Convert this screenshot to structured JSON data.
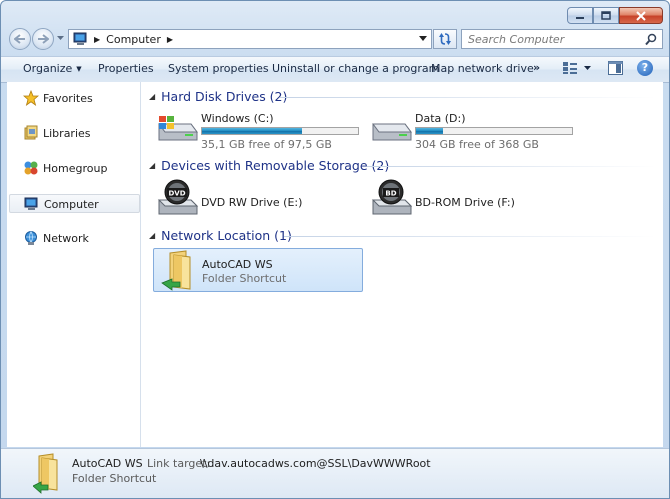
{
  "window": {
    "accent": "#c4d8ee"
  },
  "address": {
    "crumbs": [
      "Computer"
    ],
    "icon": "computer-icon"
  },
  "search": {
    "placeholder": "Search Computer"
  },
  "toolbar": {
    "organize": "Organize",
    "properties": "Properties",
    "system_properties": "System properties",
    "uninstall": "Uninstall or change a program",
    "map_drive": "Map network drive",
    "more": "»",
    "help": "?"
  },
  "nav": {
    "favorites": "Favorites",
    "libraries": "Libraries",
    "homegroup": "Homegroup",
    "computer": "Computer",
    "network": "Network"
  },
  "groups": {
    "hdd": {
      "title": "Hard Disk Drives (2)"
    },
    "removable": {
      "title": "Devices with Removable Storage (2)"
    },
    "network": {
      "title": "Network Location (1)"
    }
  },
  "drives": {
    "c": {
      "name": "Windows (C:)",
      "free": "35,1 GB free of 97,5 GB",
      "used_fraction": 0.64
    },
    "d": {
      "name": "Data (D:)",
      "free": "304 GB free of 368 GB",
      "used_fraction": 0.17
    },
    "e": {
      "name": "DVD RW Drive (E:)",
      "badge": "DVD"
    },
    "f": {
      "name": "BD-ROM Drive (F:)",
      "badge": "BD"
    }
  },
  "network_item": {
    "name": "AutoCAD WS",
    "type": "Folder Shortcut"
  },
  "details": {
    "name": "AutoCAD WS",
    "type": "Folder Shortcut",
    "link_label": "Link target:",
    "link_value": "\\\\dav.autocadws.com@SSL\\DavWWWRoot"
  }
}
